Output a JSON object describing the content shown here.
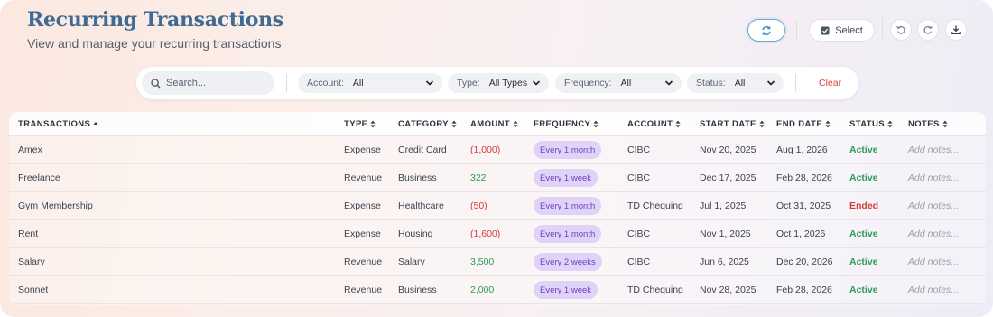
{
  "header": {
    "title": "Recurring Transactions",
    "subtitle": "View and manage your recurring transactions",
    "select_label": "Select"
  },
  "filters": {
    "search_placeholder": "Search...",
    "account_label": "Account:",
    "account_value": "All",
    "type_label": "Type:",
    "type_value": "All Types",
    "frequency_label": "Frequency:",
    "frequency_value": "All",
    "status_label": "Status:",
    "status_value": "All",
    "clear_label": "Clear"
  },
  "table": {
    "columns": [
      "TRANSACTIONS",
      "TYPE",
      "CATEGORY",
      "AMOUNT",
      "FREQUENCY",
      "ACCOUNT",
      "START DATE",
      "END DATE",
      "STATUS",
      "NOTES"
    ],
    "rows": [
      {
        "name": "Amex",
        "type": "Expense",
        "category": "Credit Card",
        "amount": "(1,000)",
        "frequency": "Every 1 month",
        "account": "CIBC",
        "start": "Nov 20, 2025",
        "end": "Aug 1, 2026",
        "status": "Active",
        "notes": "Add notes..."
      },
      {
        "name": "Freelance",
        "type": "Revenue",
        "category": "Business",
        "amount": "322",
        "frequency": "Every 1 week",
        "account": "CIBC",
        "start": "Dec 17, 2025",
        "end": "Feb 28, 2026",
        "status": "Active",
        "notes": "Add notes..."
      },
      {
        "name": "Gym Membership",
        "type": "Expense",
        "category": "Healthcare",
        "amount": "(50)",
        "frequency": "Every 1 month",
        "account": "TD Chequing",
        "start": "Jul 1, 2025",
        "end": "Oct 31, 2025",
        "status": "Ended",
        "notes": "Add notes..."
      },
      {
        "name": "Rent",
        "type": "Expense",
        "category": "Housing",
        "amount": "(1,600)",
        "frequency": "Every 1 month",
        "account": "CIBC",
        "start": "Nov 1, 2025",
        "end": "Oct 1, 2026",
        "status": "Active",
        "notes": "Add notes..."
      },
      {
        "name": "Salary",
        "type": "Revenue",
        "category": "Salary",
        "amount": "3,500",
        "frequency": "Every 2 weeks",
        "account": "CIBC",
        "start": "Jun 6, 2025",
        "end": "Dec 20, 2026",
        "status": "Active",
        "notes": "Add notes..."
      },
      {
        "name": "Sonnet",
        "type": "Revenue",
        "category": "Business",
        "amount": "2,000",
        "frequency": "Every 1 week",
        "account": "TD Chequing",
        "start": "Nov 28, 2025",
        "end": "Feb 28, 2026",
        "status": "Active",
        "notes": "Add notes..."
      }
    ]
  },
  "colors": {
    "title": "#3f6a93",
    "negative": "#d53a3a",
    "positive": "#2f9a57",
    "pill_bg": "#e0d3f7",
    "pill_text": "#6a43c4",
    "clear": "#d9443c"
  }
}
